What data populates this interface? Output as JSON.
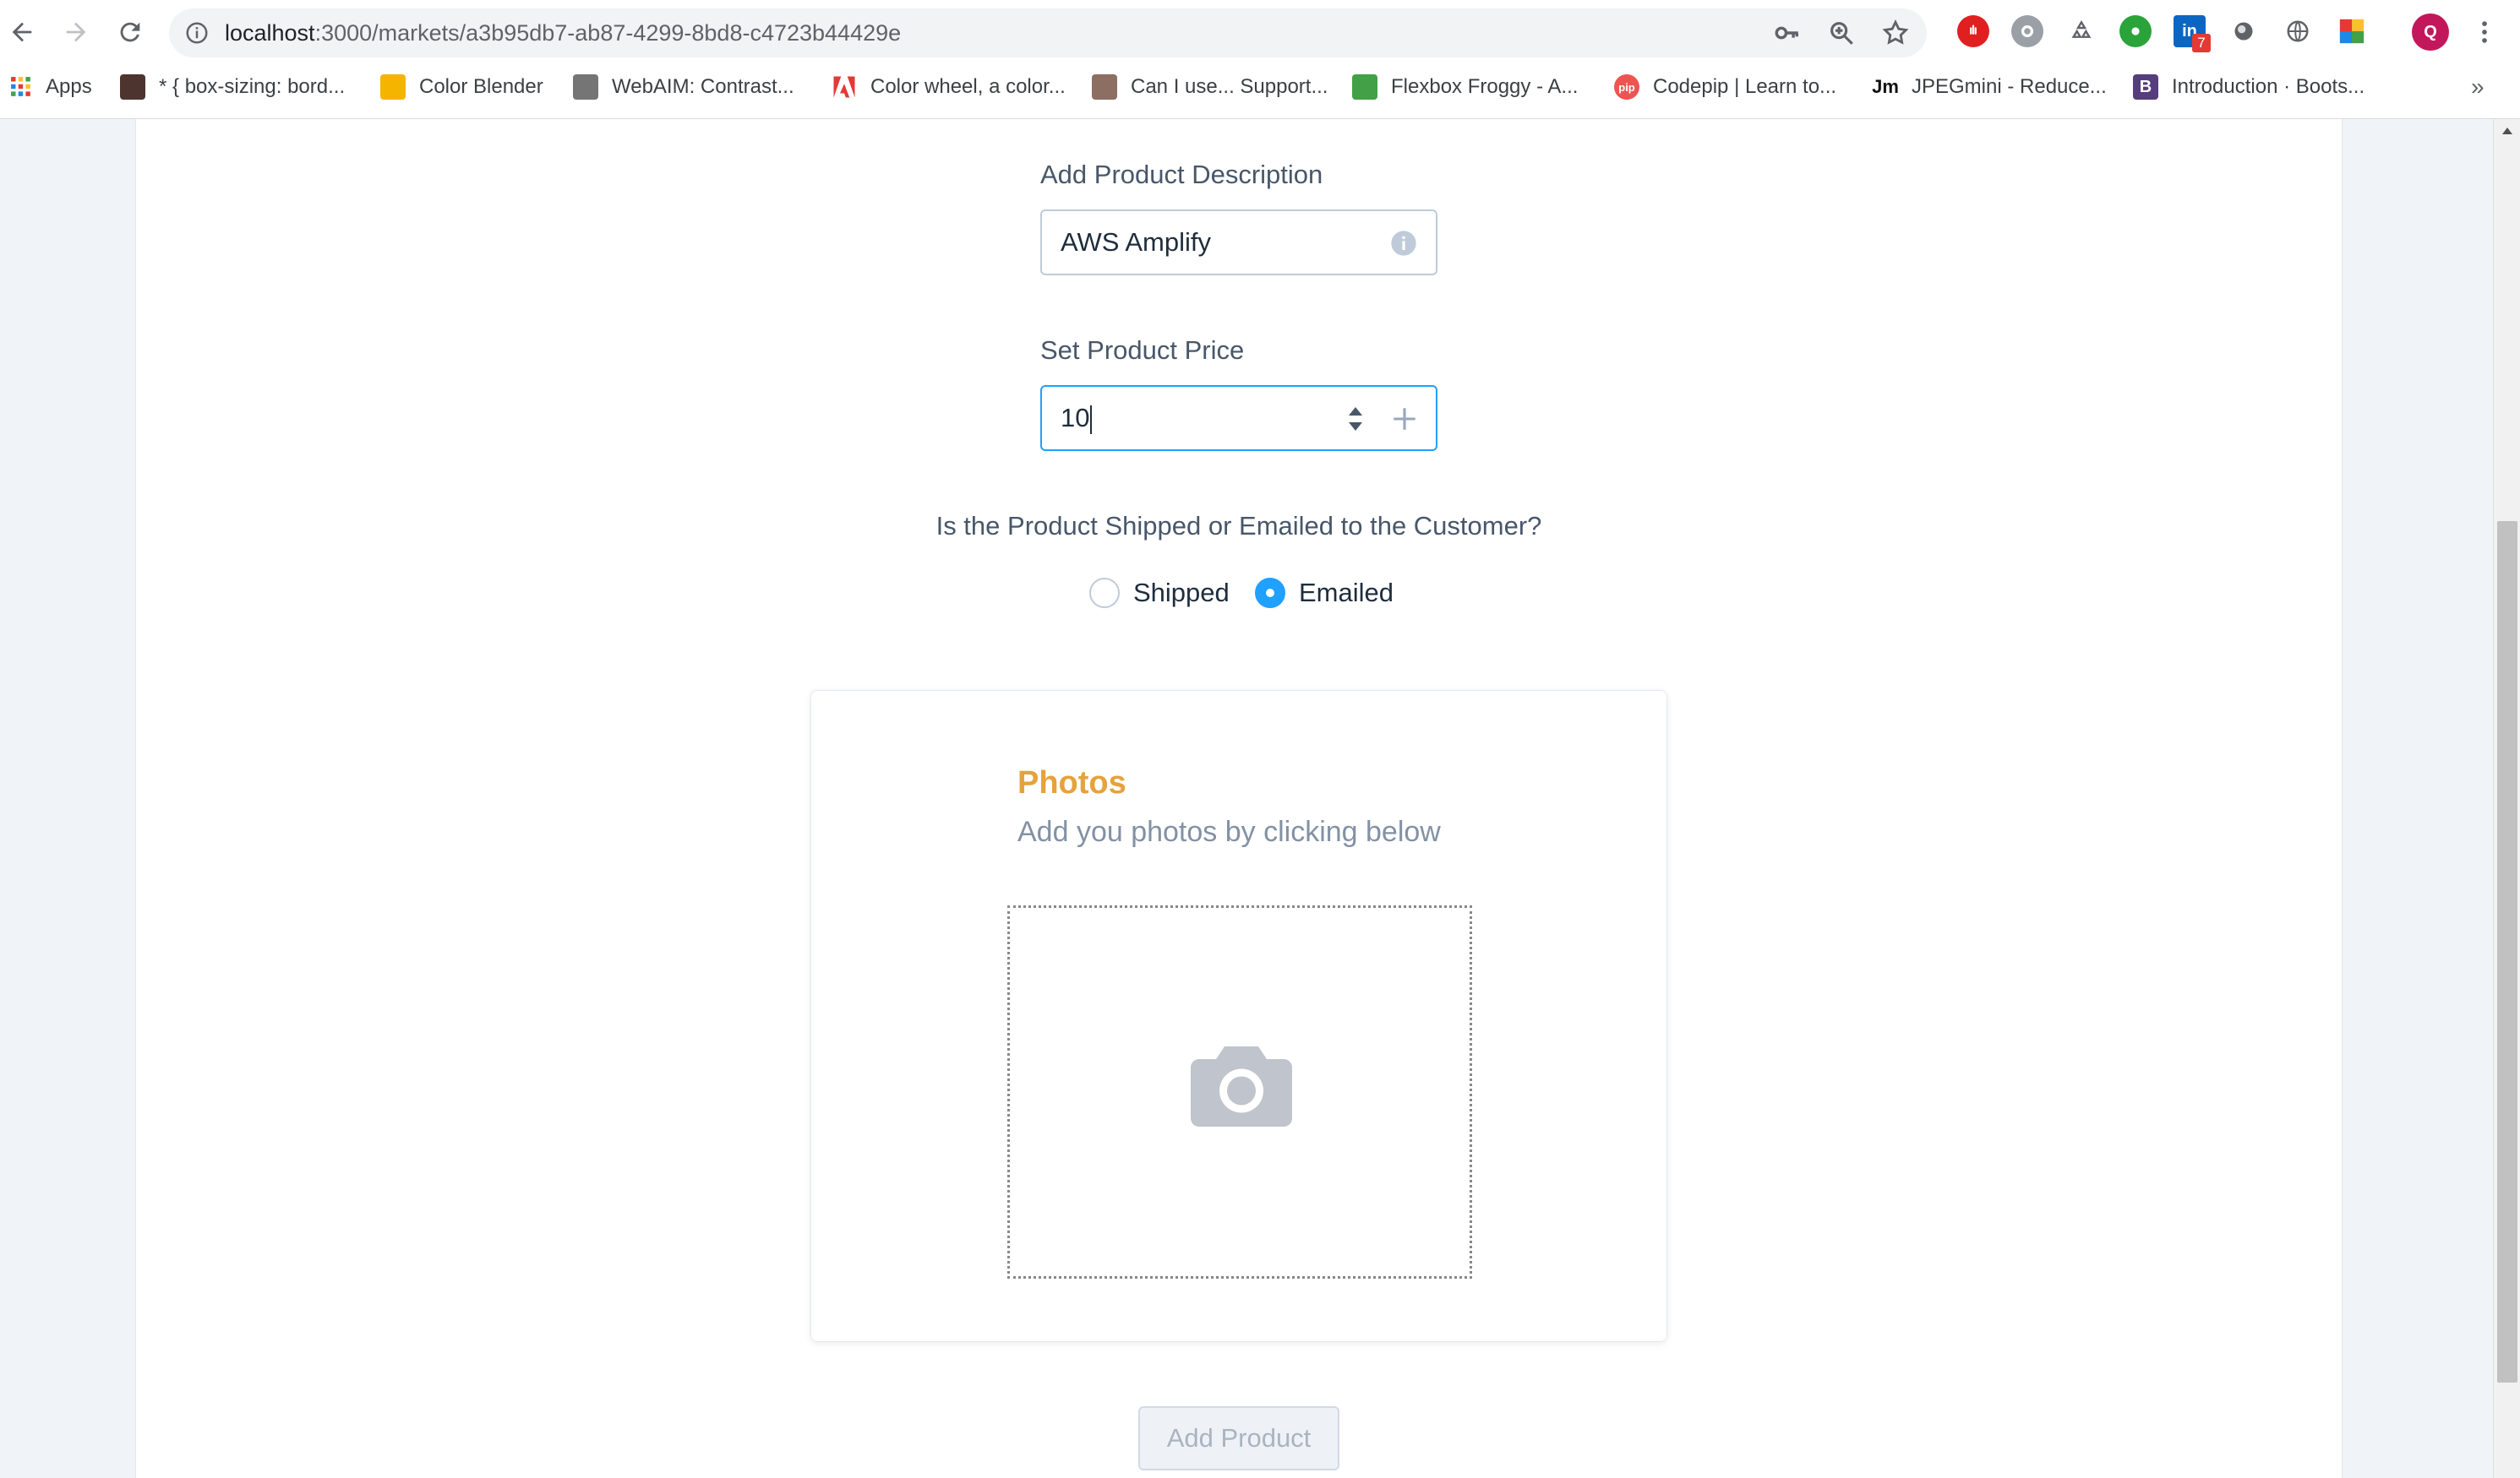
{
  "browser": {
    "url_host": "localhost",
    "url_rest": ":3000/markets/a3b95db7-ab87-4299-8bd8-c4723b44429e",
    "profile_initial": "Q",
    "linkedin_badge": "7",
    "bookmarks": [
      {
        "label": "Apps",
        "icon": "apps-grid-icon"
      },
      {
        "label": "* { box-sizing: bord...",
        "icon": "person-favicon"
      },
      {
        "label": "Color Blender",
        "icon": "color-blender-favicon"
      },
      {
        "label": "WebAIM: Contrast...",
        "icon": "webaim-favicon"
      },
      {
        "label": "Color wheel, a color...",
        "icon": "adobe-favicon"
      },
      {
        "label": "Can I use... Support...",
        "icon": "caniuse-favicon"
      },
      {
        "label": "Flexbox Froggy - A...",
        "icon": "frog-favicon"
      },
      {
        "label": "Codepip | Learn to...",
        "icon": "codepip-favicon"
      },
      {
        "label": "JPEGmini - Reduce...",
        "icon": "jpegmini-favicon"
      },
      {
        "label": "Introduction · Boots...",
        "icon": "bootstrap-favicon"
      }
    ],
    "favicon_text": {
      "jpegmini": "Jm",
      "bootstrap": "B",
      "codepip": "pip"
    }
  },
  "form": {
    "description_label": "Add Product Description",
    "description_value": "AWS Amplify",
    "price_label": "Set Product Price",
    "price_value": "10",
    "shipping_question": "Is the Product Shipped or Emailed to the Customer?",
    "shipping_options": [
      {
        "label": "Shipped",
        "selected": false
      },
      {
        "label": "Emailed",
        "selected": true
      }
    ],
    "photos_title": "Photos",
    "photos_subtitle": "Add you photos by clicking below",
    "submit_label": "Add Product"
  },
  "colors": {
    "accent": "#20a0ff",
    "photos_title": "#e6a23c",
    "label": "#48576a"
  }
}
